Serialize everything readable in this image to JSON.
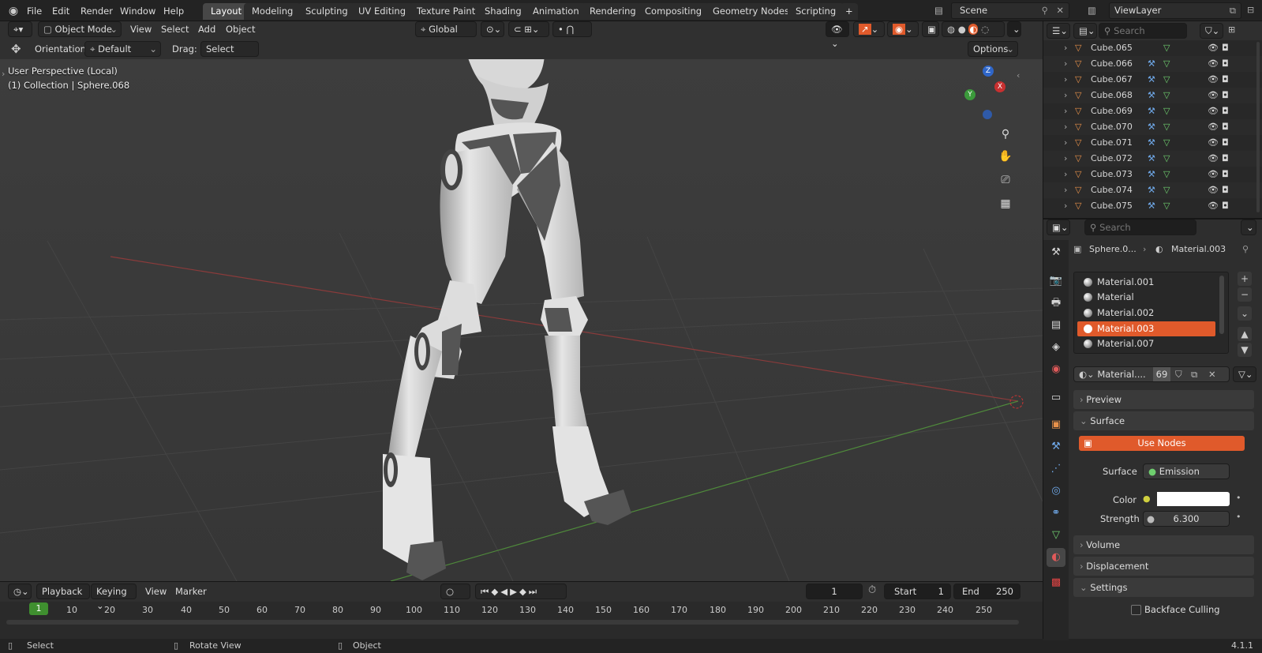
{
  "menu": {
    "items": [
      "File",
      "Edit",
      "Render",
      "Window",
      "Help"
    ]
  },
  "workspaces": {
    "tabs": [
      "Layout",
      "Modeling",
      "Sculpting",
      "UV Editing",
      "Texture Paint",
      "Shading",
      "Animation",
      "Rendering",
      "Compositing",
      "Geometry Nodes",
      "Scripting"
    ],
    "active": "Layout"
  },
  "scene": {
    "name": "Scene",
    "view_layer": "ViewLayer"
  },
  "header": {
    "mode": "Object Mode",
    "menus": [
      "View",
      "Select",
      "Add",
      "Object"
    ],
    "transform_orientation": "Global",
    "orientation_label": "Orientation:",
    "orientation_value": "Default",
    "drag_label": "Drag:",
    "drag_value": "Select Box",
    "options": "Options"
  },
  "viewport": {
    "perspective": "User Perspective (Local)",
    "collection": "(1) Collection | Sphere.068",
    "gizmo": {
      "z": "Z",
      "y": "Y",
      "x": "X"
    }
  },
  "outliner": {
    "search_placeholder": "Search",
    "rows": [
      "Cube.065",
      "Cube.066",
      "Cube.067",
      "Cube.068",
      "Cube.069",
      "Cube.070",
      "Cube.071",
      "Cube.072",
      "Cube.073",
      "Cube.074",
      "Cube.075"
    ]
  },
  "properties": {
    "search_placeholder": "Search",
    "breadcrumb_object": "Sphere.0...",
    "breadcrumb_material": "Material.003",
    "materials": [
      "Material.001",
      "Material",
      "Material.002",
      "Material.003",
      "Material.007"
    ],
    "selected_material": "Material.003",
    "datablock_name": "Material....",
    "user_count": "69",
    "panels": {
      "preview": "Preview",
      "surface": "Surface",
      "volume": "Volume",
      "displacement": "Displacement",
      "settings": "Settings"
    },
    "use_nodes": "Use Nodes",
    "surface_label": "Surface",
    "surface_value": "Emission",
    "color_label": "Color",
    "strength_label": "Strength",
    "strength_value": "6.300",
    "backface_culling": "Backface Culling"
  },
  "timeline": {
    "menus": [
      "Playback",
      "Keying",
      "View",
      "Marker"
    ],
    "current_frame": "1",
    "start_label": "Start",
    "start_value": "1",
    "end_label": "End",
    "end_value": "250",
    "ticks": [
      "1",
      "10",
      "20",
      "30",
      "40",
      "50",
      "60",
      "70",
      "80",
      "90",
      "100",
      "110",
      "120",
      "130",
      "140",
      "150",
      "160",
      "170",
      "180",
      "190",
      "200",
      "210",
      "220",
      "230",
      "240",
      "250"
    ]
  },
  "statusbar": {
    "select": "Select",
    "rotate": "Rotate View",
    "object": "Object",
    "version": "4.1.1"
  },
  "colors": {
    "accent": "#e05a2b",
    "active_tab": "#474747",
    "grid_x": "#8a3b3b",
    "grid_y": "#4f8a3b",
    "frame_marker": "#3f8f2f"
  }
}
